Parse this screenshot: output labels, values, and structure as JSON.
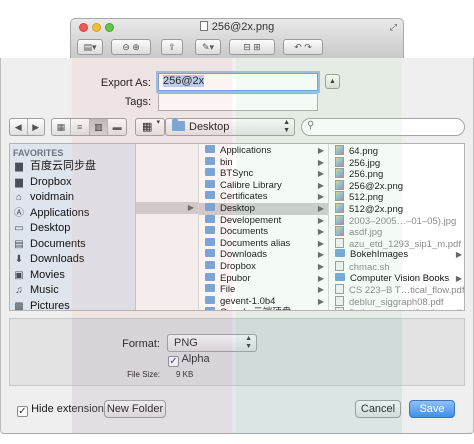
{
  "window": {
    "title": "256@2x.png"
  },
  "export": {
    "export_as_label": "Export As:",
    "filename": "256@2x",
    "tags_label": "Tags:",
    "tags_value": ""
  },
  "browser": {
    "location": "Desktop",
    "search_value": "",
    "sidebar": {
      "title": "FAVORITES",
      "items": [
        {
          "label": "百度云同步盘",
          "icon": "folder-icon"
        },
        {
          "label": "Dropbox",
          "icon": "folder-icon"
        },
        {
          "label": "voidmain",
          "icon": "home-icon"
        },
        {
          "label": "Applications",
          "icon": "applications-icon"
        },
        {
          "label": "Desktop",
          "icon": "desktop-icon"
        },
        {
          "label": "Documents",
          "icon": "documents-icon"
        },
        {
          "label": "Downloads",
          "icon": "downloads-icon"
        },
        {
          "label": "Movies",
          "icon": "movies-icon"
        },
        {
          "label": "Music",
          "icon": "music-icon"
        },
        {
          "label": "Pictures",
          "icon": "pictures-icon"
        }
      ]
    },
    "column2": [
      {
        "label": "Applications"
      },
      {
        "label": "bin"
      },
      {
        "label": "BTSync"
      },
      {
        "label": "Calibre Library"
      },
      {
        "label": "Certificates"
      },
      {
        "label": "Desktop",
        "selected": true
      },
      {
        "label": "Developement"
      },
      {
        "label": "Documents"
      },
      {
        "label": "Documents alias"
      },
      {
        "label": "Downloads"
      },
      {
        "label": "Dropbox"
      },
      {
        "label": "Epubor"
      },
      {
        "label": "File"
      },
      {
        "label": "gevent-1.0b4"
      },
      {
        "label": "Google 云端硬盘"
      }
    ],
    "column3": [
      {
        "label": "64.png",
        "kind": "image",
        "dim": false
      },
      {
        "label": "256.jpg",
        "kind": "image",
        "dim": false
      },
      {
        "label": "256.png",
        "kind": "image",
        "dim": false
      },
      {
        "label": "256@2x.png",
        "kind": "image",
        "dim": false
      },
      {
        "label": "512.png",
        "kind": "image",
        "dim": false
      },
      {
        "label": "512@2x.png",
        "kind": "image",
        "dim": false
      },
      {
        "label": "2003–2005…–01–05).jpg",
        "kind": "image",
        "dim": true
      },
      {
        "label": "asdf.jpg",
        "kind": "image",
        "dim": true
      },
      {
        "label": "azu_etd_1293_sip1_m.pdf",
        "kind": "doc",
        "dim": true
      },
      {
        "label": "BokehImages",
        "kind": "folder",
        "dim": false
      },
      {
        "label": "chmac.sh",
        "kind": "doc",
        "dim": true
      },
      {
        "label": "Computer Vision Books",
        "kind": "folder",
        "dim": false
      },
      {
        "label": "CS 223–B T…tical_flow.pdf",
        "kind": "doc",
        "dim": true
      },
      {
        "label": "deblur_siggraph08.pdf",
        "kind": "doc",
        "dim": true
      },
      {
        "label": "Defocus_magnification.pdf",
        "kind": "doc",
        "dim": true
      }
    ]
  },
  "format_panel": {
    "format_label": "Format:",
    "format_value": "PNG",
    "alpha_label": "Alpha",
    "alpha_checked": true,
    "file_size_label": "File Size:",
    "file_size_value": "9 KB"
  },
  "footer": {
    "hide_extension_label": "Hide extension",
    "hide_extension_checked": true,
    "new_folder_label": "New Folder",
    "cancel_label": "Cancel",
    "save_label": "Save"
  },
  "colors": {
    "accent": "#3f8fe7",
    "selection": "#cfcfcf",
    "sidebar": "#dfe5ec"
  }
}
